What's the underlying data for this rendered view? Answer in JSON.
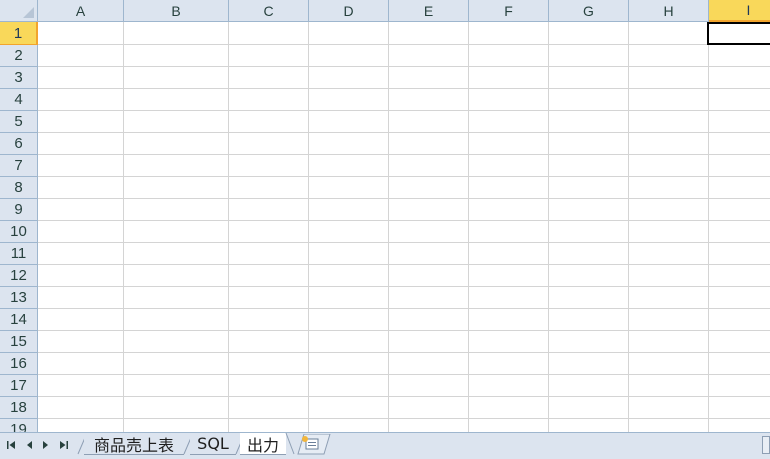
{
  "grid": {
    "columns": [
      "A",
      "B",
      "C",
      "D",
      "E",
      "F",
      "G",
      "H",
      "I"
    ],
    "active_column": "I",
    "rows": [
      "1",
      "2",
      "3",
      "4",
      "5",
      "6",
      "7",
      "8",
      "9",
      "10",
      "11",
      "12",
      "13",
      "14",
      "15",
      "16",
      "17",
      "18",
      "19"
    ],
    "active_row": "1",
    "selected_cell": "I1"
  },
  "sheet_tabs": [
    {
      "label": "商品売上表",
      "active": false
    },
    {
      "label": "SQL",
      "active": false
    },
    {
      "label": "出力",
      "active": true
    }
  ],
  "icons": {
    "first_sheet": "first-sheet-icon",
    "prev_sheet": "prev-sheet-icon",
    "next_sheet": "next-sheet-icon",
    "last_sheet": "last-sheet-icon",
    "insert_sheet": "insert-sheet-icon"
  },
  "colors": {
    "header_bg": "#dce4ef",
    "active_header_bg": "#f9d85a",
    "active_header_border": "#f2a42d",
    "gridline": "#d4d4d4"
  }
}
